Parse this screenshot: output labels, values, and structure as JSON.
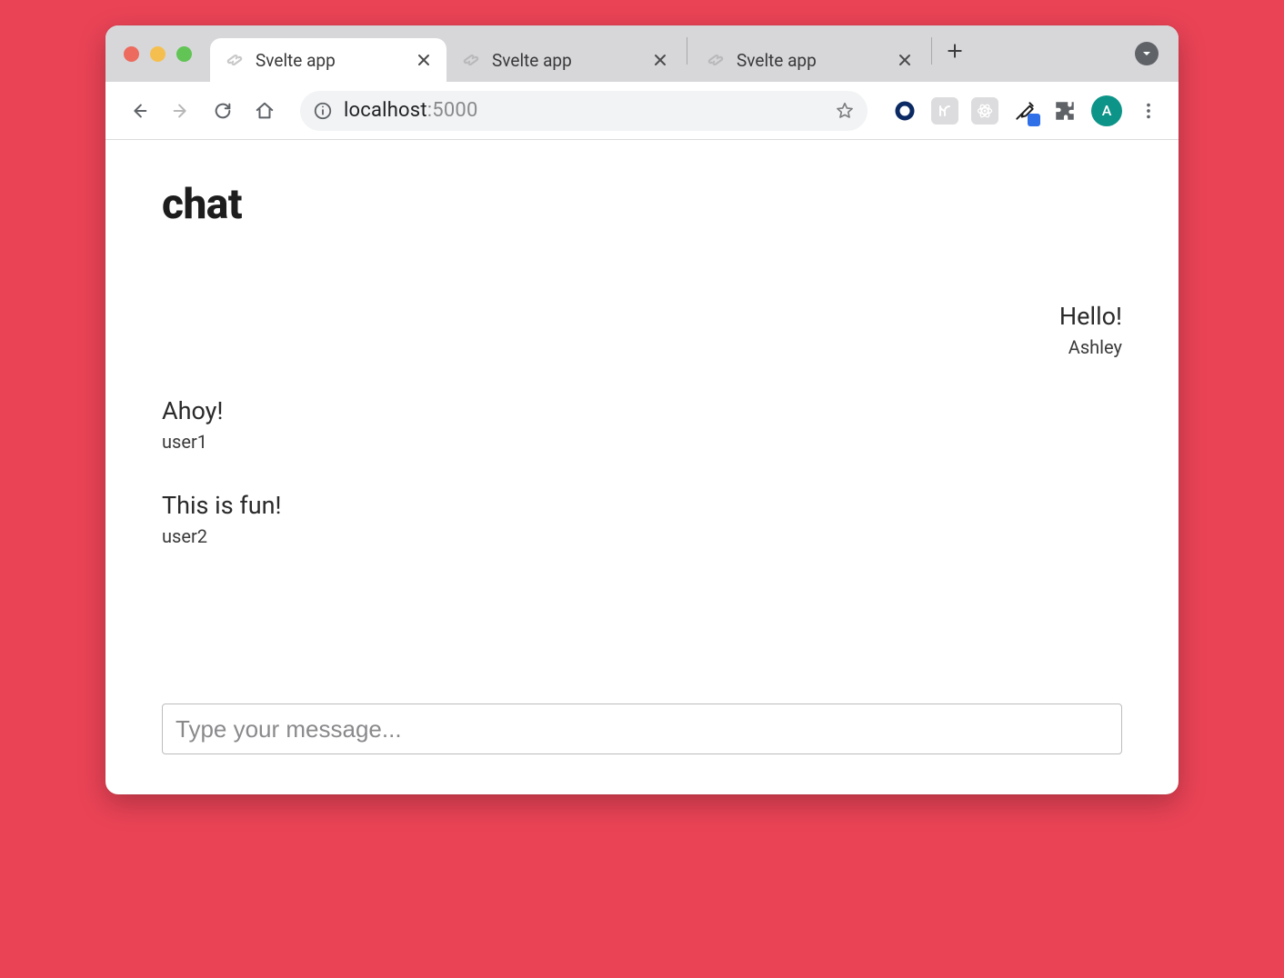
{
  "browser": {
    "tabs": [
      {
        "title": "Svelte app",
        "active": true
      },
      {
        "title": "Svelte app",
        "active": false
      },
      {
        "title": "Svelte app",
        "active": false
      }
    ],
    "url_host": "localhost",
    "url_port": ":5000",
    "avatar_initial": "A"
  },
  "page": {
    "title": "chat",
    "messages": [
      {
        "text": "Hello!",
        "author": "Ashley",
        "side": "right"
      },
      {
        "text": "Ahoy!",
        "author": "user1",
        "side": "left"
      },
      {
        "text": "This is fun!",
        "author": "user2",
        "side": "left"
      }
    ],
    "composer_placeholder": "Type your message..."
  }
}
